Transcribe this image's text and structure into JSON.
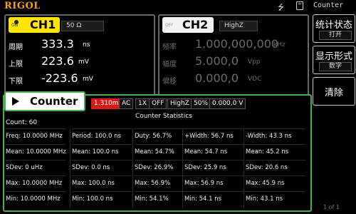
{
  "header": {
    "brand": "RIGOL",
    "usb_icon": "usb-icon",
    "lock_icon": "lock-icon"
  },
  "ch1": {
    "state": "ON",
    "name": "CH1",
    "impedance": "50 Ω",
    "rows": [
      {
        "label": "周期",
        "value": "333.3",
        "unit": "ns"
      },
      {
        "label": "上限",
        "value": "223.6",
        "unit": "mV"
      },
      {
        "label": "下限",
        "value": "-223.6",
        "unit": "mV"
      }
    ]
  },
  "ch2": {
    "state": "OFF",
    "name": "CH2",
    "impedance": "HighZ",
    "rows": [
      {
        "label": "频率",
        "value": "1.000,000,000",
        "unit": "kHz"
      },
      {
        "label": "幅度",
        "value": "5.000,0",
        "unit": "Vpp"
      },
      {
        "label": "偏移",
        "value": "0.000,0",
        "unit": "VDC"
      }
    ]
  },
  "menu": {
    "title": "Counter",
    "items": [
      {
        "label": "统计状态",
        "sub": "打开"
      },
      {
        "label": "显示形式",
        "sub": "数字"
      },
      {
        "label": "清除",
        "sub": ""
      }
    ],
    "page": "1 of 1"
  },
  "counter": {
    "title": "Counter",
    "settings": [
      "1.310ms",
      "AC",
      "1X",
      "OFF",
      "HighZ",
      "50%",
      "0.000,0 V"
    ],
    "stats_title": "Counter Statistics",
    "count": "Count: 60",
    "columns": [
      [
        "Freq: 10.0000 MHz",
        "Mean: 10.0000 MHz",
        "SDev: 0 uHz",
        "Max: 10.0000 MHz",
        "Min: 10.0000 MHz"
      ],
      [
        "Period: 100.0 ns",
        "Mean: 100.0 ns",
        "SDev: 0.0 ns",
        "Max: 100.0 ns",
        "Min: 100.0 ns"
      ],
      [
        "Duty: 56.7%",
        "Mean: 54.7%",
        "SDev: 26.9%",
        "Max: 56.9%",
        "Min: 54.1%"
      ],
      [
        "+Width: 56.7 ns",
        "Mean: 54.7 ns",
        "SDev: 25.9 ns",
        "Max: 56.9 ns",
        "Min: 54.1 ns"
      ],
      [
        "-Width: 43.3 ns",
        "Mean: 45.2 ns",
        "SDev: 20.6 ns",
        "Max: 45.9 ns",
        "Min: 43.1 ns"
      ]
    ]
  }
}
